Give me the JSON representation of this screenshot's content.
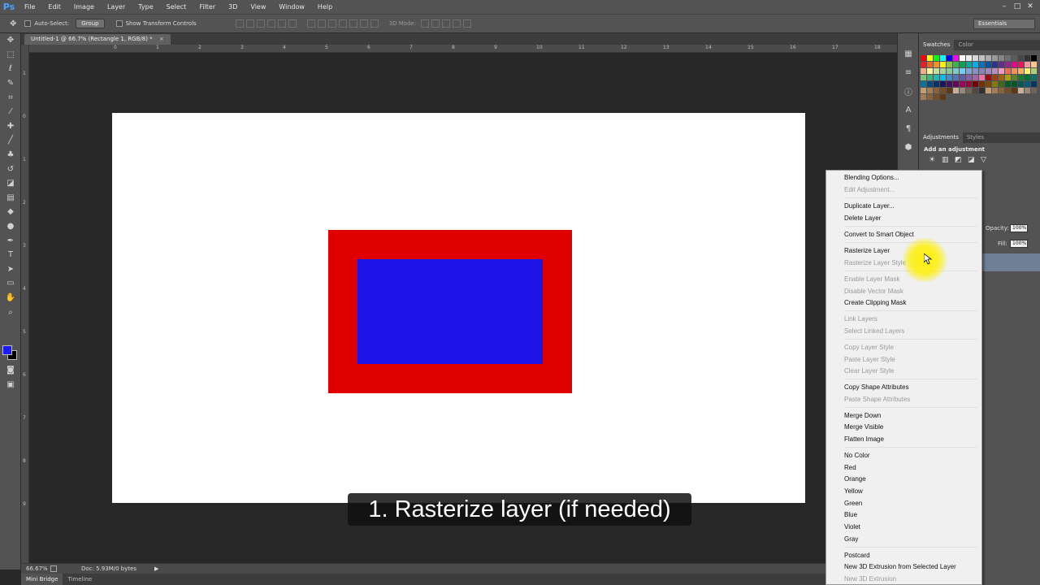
{
  "app": {
    "logo": "Ps"
  },
  "menus": [
    "File",
    "Edit",
    "Image",
    "Layer",
    "Type",
    "Select",
    "Filter",
    "3D",
    "View",
    "Window",
    "Help"
  ],
  "window_controls": [
    "–",
    "□",
    "✕"
  ],
  "options_bar": {
    "auto_select_label": "Auto-Select:",
    "auto_select_value": "Group",
    "show_transform_label": "Show Transform Controls",
    "mode3d_label": "3D Mode:",
    "workspace": "Essentials"
  },
  "document": {
    "tab_title": "Untitled-1 @ 66.7% (Rectangle 1, RGB/8) *",
    "close": "×"
  },
  "rulers": {
    "top": [
      "0",
      "1",
      "2",
      "3",
      "4",
      "5",
      "6",
      "7",
      "8",
      "9",
      "10",
      "11",
      "12",
      "13",
      "14",
      "15",
      "16",
      "17",
      "18",
      "19",
      "20"
    ],
    "left": [
      "1",
      "0",
      "1",
      "2",
      "3",
      "4",
      "5",
      "6",
      "7",
      "8",
      "9"
    ]
  },
  "canvas": {
    "background_color": "#ffffff",
    "outer_rect_color": "#e00000",
    "inner_rect_color": "#1c14e6"
  },
  "caption": "1. Rasterize layer (if needed)",
  "status_bar": {
    "zoom": "66.67%",
    "doc_size": "Doc: 5.93M/0 bytes",
    "arrow": "▶"
  },
  "bottom_tabs": [
    "Mini Bridge",
    "Timeline"
  ],
  "panels": {
    "swatch_tabs": [
      "Swatches",
      "Color"
    ],
    "adjustment_tabs": [
      "Adjustments",
      "Styles"
    ],
    "adjustment_title": "Add an adjustment",
    "opacity_label": "Opacity:",
    "opacity_value": "100%",
    "fill_label": "Fill:",
    "fill_value": "100%"
  },
  "context_menu": [
    {
      "label": "Blending Options...",
      "enabled": true
    },
    {
      "label": "Edit Adjustment...",
      "enabled": false
    },
    {
      "label": "Duplicate Layer...",
      "enabled": true
    },
    {
      "label": "Delete Layer",
      "enabled": true
    },
    {
      "label": "Convert to Smart Object",
      "enabled": true
    },
    {
      "label": "Rasterize Layer",
      "enabled": true
    },
    {
      "label": "Rasterize Layer Style",
      "enabled": false
    },
    {
      "label": "Enable Layer Mask",
      "enabled": false
    },
    {
      "label": "Disable Vector Mask",
      "enabled": false
    },
    {
      "label": "Create Clipping Mask",
      "enabled": true
    },
    {
      "label": "Link Layers",
      "enabled": false
    },
    {
      "label": "Select Linked Layers",
      "enabled": false
    },
    {
      "label": "Copy Layer Style",
      "enabled": false
    },
    {
      "label": "Paste Layer Style",
      "enabled": false
    },
    {
      "label": "Clear Layer Style",
      "enabled": false
    },
    {
      "label": "Copy Shape Attributes",
      "enabled": true
    },
    {
      "label": "Paste Shape Attributes",
      "enabled": false
    },
    {
      "label": "Merge Down",
      "enabled": true
    },
    {
      "label": "Merge Visible",
      "enabled": true
    },
    {
      "label": "Flatten Image",
      "enabled": true
    },
    {
      "label": "No Color",
      "enabled": true
    },
    {
      "label": "Red",
      "enabled": true
    },
    {
      "label": "Orange",
      "enabled": true
    },
    {
      "label": "Yellow",
      "enabled": true
    },
    {
      "label": "Green",
      "enabled": true
    },
    {
      "label": "Blue",
      "enabled": true
    },
    {
      "label": "Violet",
      "enabled": true
    },
    {
      "label": "Gray",
      "enabled": true
    },
    {
      "label": "Postcard",
      "enabled": true
    },
    {
      "label": "New 3D Extrusion from Selected Layer",
      "enabled": true
    },
    {
      "label": "New 3D Extrusion",
      "enabled": false
    }
  ]
}
